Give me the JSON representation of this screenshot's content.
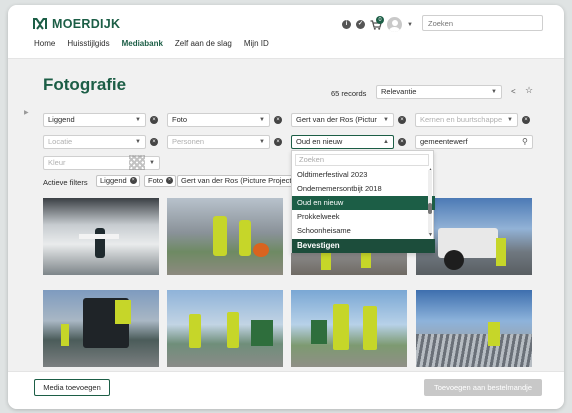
{
  "header": {
    "logo_text": "MOERDIJK",
    "search_placeholder": "Zoeken",
    "cart_count": "0",
    "info_icon_glyph": "i",
    "check_icon_glyph": "✓"
  },
  "nav": {
    "items": [
      "Home",
      "Huisstijlgids",
      "Mediabank",
      "Zelf aan de slag",
      "Mijn ID"
    ],
    "active": "Mediabank"
  },
  "page": {
    "title": "Fotografie",
    "records": "65 records",
    "sort_value": "Relevantie"
  },
  "filters": {
    "orientation": "Liggend",
    "type": "Foto",
    "photographer": "Gert van der Ros (Pictur",
    "kernen_placeholder": "Kernen en buurtschappe",
    "locatie_placeholder": "Locatie",
    "personen_placeholder": "Personen",
    "event": "Oud en nieuw",
    "keyword": "gemeentewerf",
    "kleur_placeholder": "Kleur"
  },
  "active_filters": {
    "label": "Actieve filters",
    "chips": [
      "Liggend",
      "Foto",
      "Gert van der Ros (Picture Project)"
    ]
  },
  "dropdown": {
    "search_placeholder": "Zoeken",
    "items": [
      "Oldtimerfestival 2023",
      "Ondernemersontbijt 2018",
      "Oud en nieuw",
      "Prokkelweek",
      "Schoonheisame"
    ],
    "selected": "Oud en nieuw",
    "confirm_label": "Bevestigen"
  },
  "footer": {
    "add_media": "Media toevoegen",
    "add_to_order": "Toevoegen aan bestelmandje"
  },
  "colors": {
    "brand_green": "#1c5e46",
    "brand_dark_green": "#1c4d3b",
    "page_bg": "#f1f1f1",
    "disabled_button": "#c8c8c8"
  }
}
